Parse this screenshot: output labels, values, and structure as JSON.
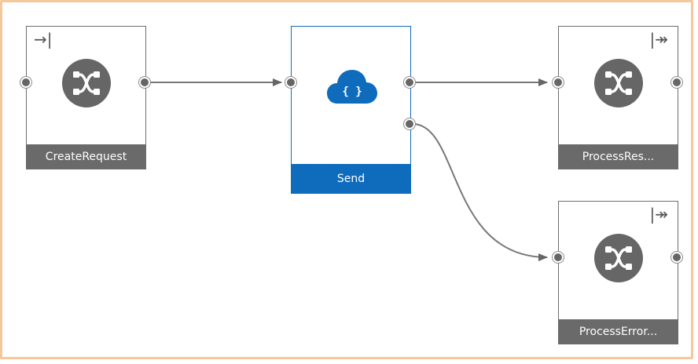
{
  "nodes": {
    "create_request": {
      "label": "CreateRequest",
      "corner_icon": "→|",
      "icon": "shuffle-icon"
    },
    "send": {
      "label": "Send",
      "icon": "cloud-json-icon",
      "icon_text": "{ }",
      "accent": "#0f6cbd"
    },
    "process_response": {
      "label": "ProcessRes...",
      "corner_icon": "|↠",
      "icon": "shuffle-icon"
    },
    "process_error": {
      "label": "ProcessError...",
      "corner_icon": "|↠",
      "icon": "shuffle-icon"
    }
  },
  "colors": {
    "canvas_border": "#f6c79a",
    "node_label_bg": "#6a6a6a",
    "selected_accent": "#0f6cbd",
    "connector": "#666666"
  }
}
